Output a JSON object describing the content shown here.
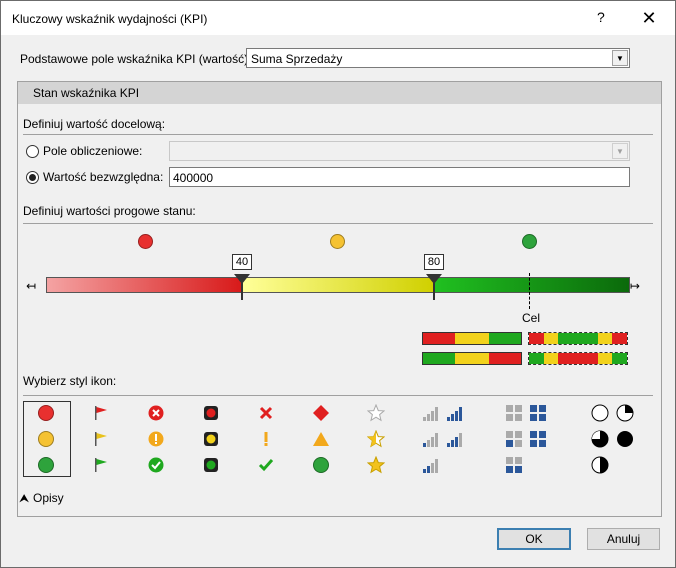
{
  "window": {
    "title": "Kluczowy wskaźnik wydajności (KPI)",
    "help_label": "?",
    "close_label": "✕"
  },
  "base_field": {
    "label": "Podstawowe pole wskaźnika KPI (wartość):",
    "value": "Suma Sprzedaży"
  },
  "status_section": {
    "header": "Stan wskaźnika KPI",
    "target_label": "Definiuj wartość docelową:",
    "calculated_field": {
      "label": "Pole obliczeniowe:",
      "selected": false,
      "value": ""
    },
    "absolute_value": {
      "label": "Wartość bezwzględna:",
      "selected": true,
      "value": "400000"
    },
    "thresholds_label": "Definiuj wartości progowe stanu:",
    "threshold_low": "40",
    "threshold_high": "80",
    "target_marker": "Cel",
    "status_colors": {
      "red": "#e02020",
      "yellow": "#f2d21c",
      "green": "#1fa81f"
    },
    "icon_style_label": "Wybierz styl ikon:",
    "icon_styles": [
      {
        "name": "circles",
        "selected": true
      },
      {
        "name": "flags"
      },
      {
        "name": "symbols-circled"
      },
      {
        "name": "traffic-lights"
      },
      {
        "name": "symbols-uncircled"
      },
      {
        "name": "shapes"
      },
      {
        "name": "stars"
      },
      {
        "name": "signal-bars"
      },
      {
        "name": "quarter-boxes"
      },
      {
        "name": "pie-circles"
      }
    ]
  },
  "descriptions_label": "Opisy",
  "buttons": {
    "ok": "OK",
    "cancel": "Anuluj"
  }
}
